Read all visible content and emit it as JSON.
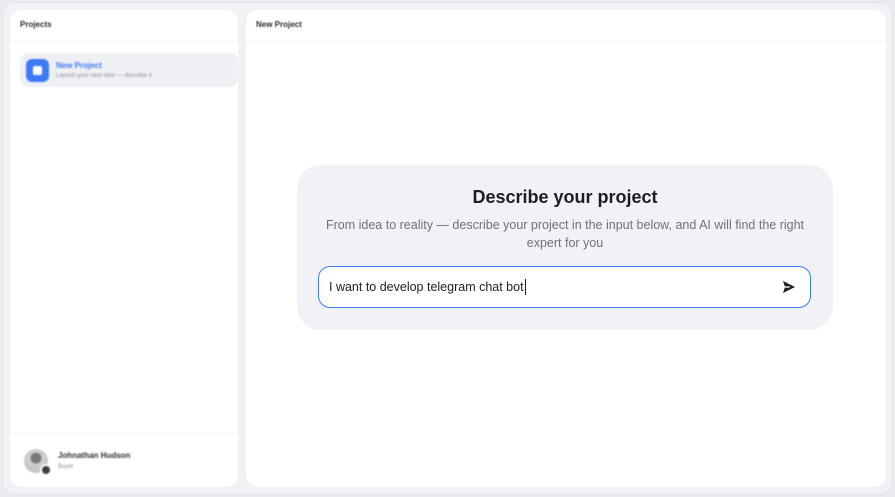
{
  "sidebar": {
    "header": "Projects",
    "items": [
      {
        "name": "New Project",
        "subtitle": "Launch your next idea — describe it"
      }
    ],
    "user": {
      "name": "Johnathan Hudson",
      "role": "Buyer"
    }
  },
  "main": {
    "header": "New Project",
    "card": {
      "title": "Describe your project",
      "description": "From idea to reality — describe your project in the input below, and AI will find the right expert for you",
      "input_value": "I want to develop telegram chat bot"
    }
  },
  "colors": {
    "accent": "#3d7bf5",
    "background": "#f1f2f5",
    "text_primary": "#1c1e23",
    "text_secondary": "#6d717b"
  },
  "icons": {
    "project": "square-icon",
    "send": "send-icon",
    "user_badge": "badge-icon"
  }
}
